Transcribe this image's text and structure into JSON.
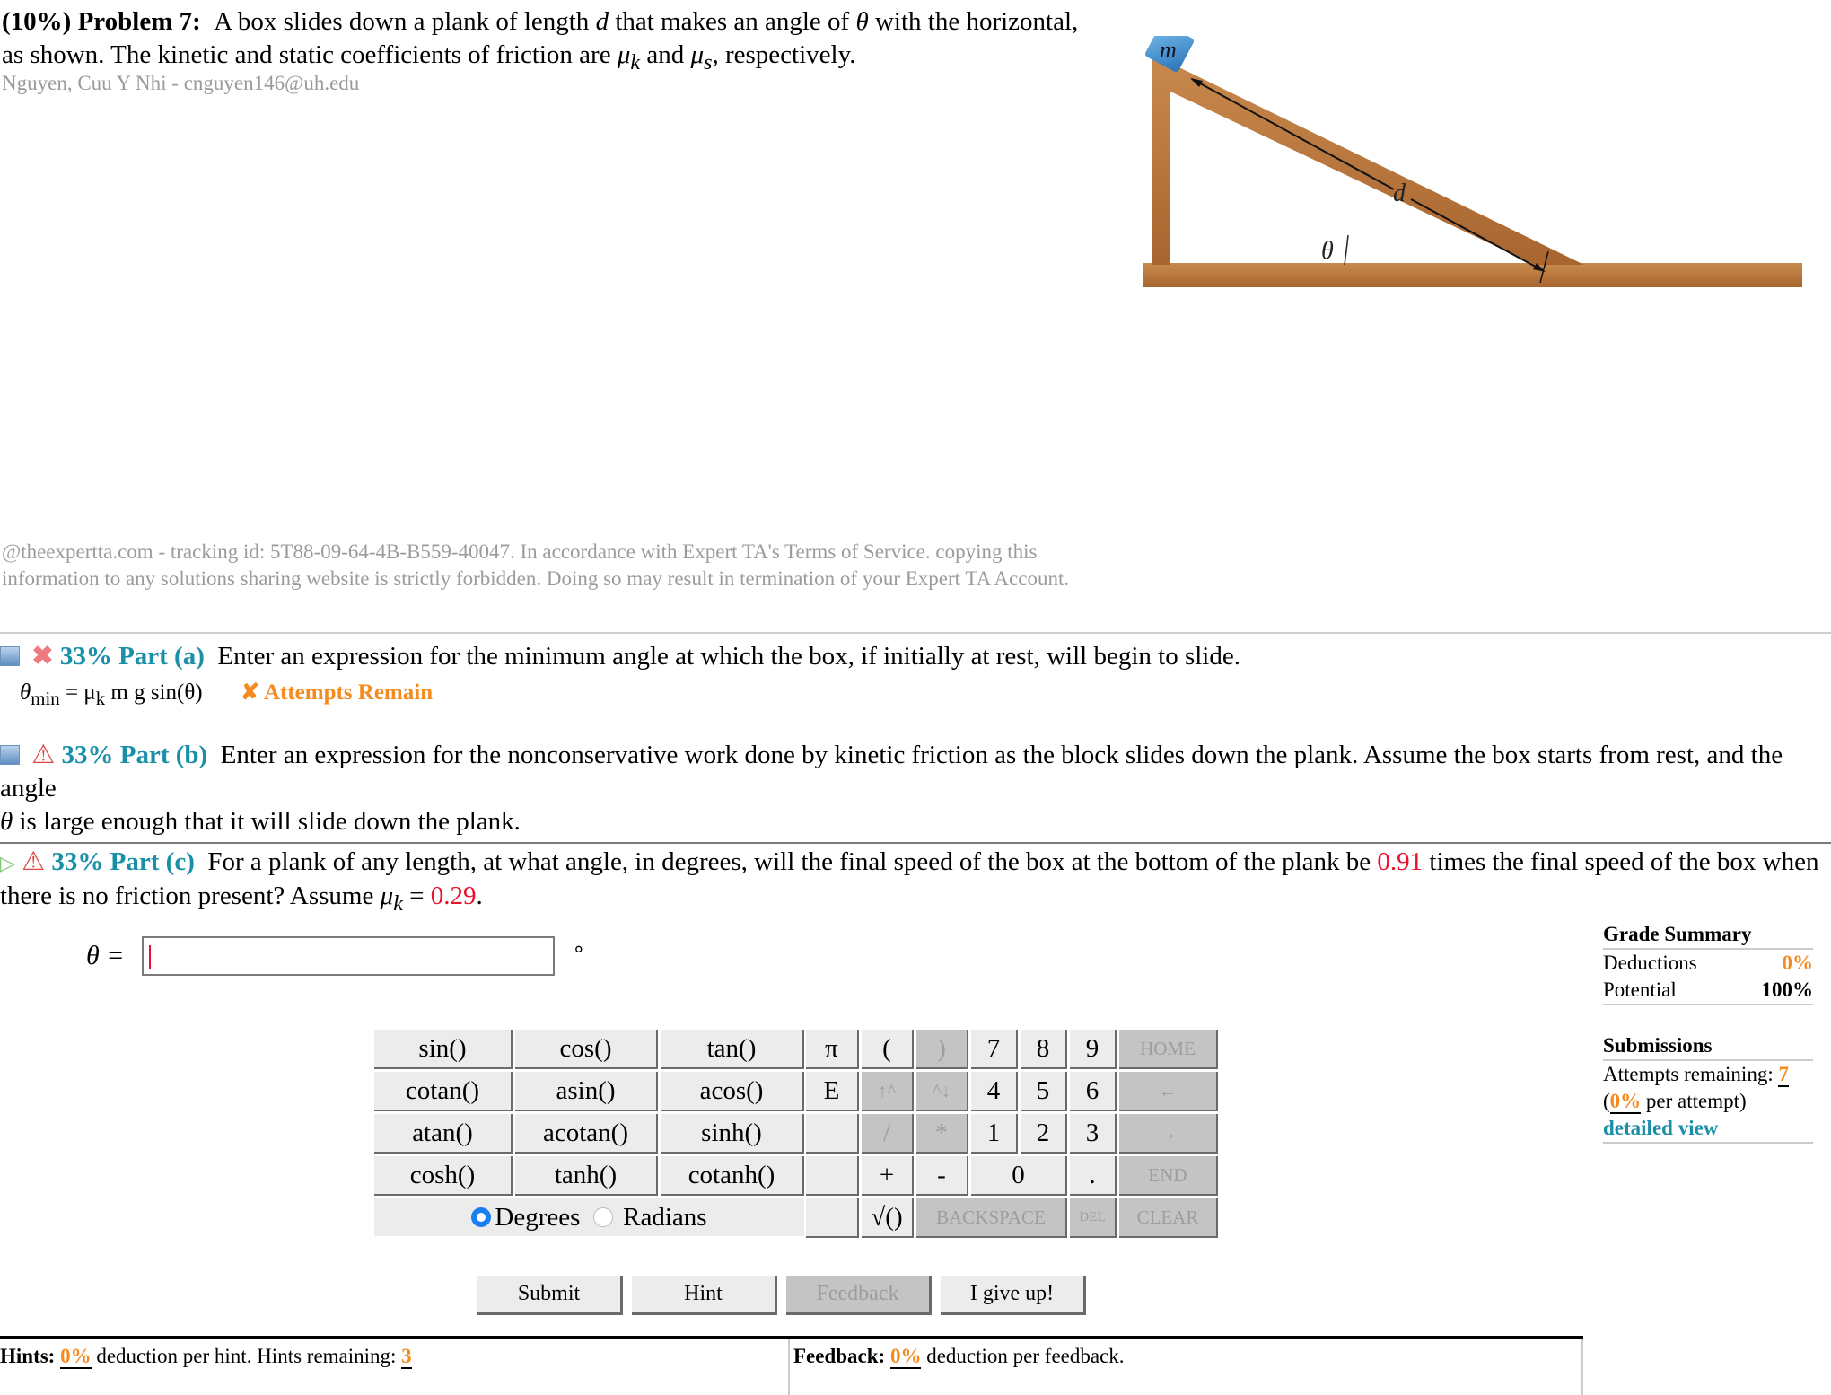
{
  "problem": {
    "weight": "(10%)",
    "label": "Problem 7:",
    "text_1": "A box slides down a plank of length",
    "var_d": "d",
    "text_2": "that makes an angle of",
    "var_theta": "θ",
    "text_3": "with the horizontal, as shown. The kinetic and static coefficients of friction are",
    "mu_k": "μ",
    "mu_k_sub": "k",
    "and": "and",
    "mu_s": "μ",
    "mu_s_sub": "s",
    "text_4": ", respectively.",
    "student": "Nguyen, Cuu Y Nhi - cnguyen146@uh.edu"
  },
  "figure": {
    "mass_label": "m",
    "length_label": "d",
    "angle_label": "θ",
    "colors": {
      "wood": "#b8763e",
      "box": "#3f8fd1"
    }
  },
  "copyright": "@theexpertta.com - tracking id: 5T88-09-64-4B-B559-40047. In accordance with Expert TA's Terms of Service. copying this information to any solutions sharing website is strictly forbidden. Doing so may result in termination of your Expert TA Account.",
  "parts": {
    "a": {
      "icon": "collapse-icon",
      "status_icon": "incorrect-icon",
      "tag": "33% Part (a)",
      "text": "Enter an expression for the minimum angle at which the box, if initially at rest, will begin to slide.",
      "answer_lhs": "θ",
      "answer_lhs_sub": "min",
      "answer_rhs": "= μ",
      "answer_rhs_sub": "k",
      "answer_rest": " m g sin(θ)",
      "status": "✘ Attempts Remain"
    },
    "b": {
      "tag": "33% Part (b)",
      "text_1": "Enter an expression for the nonconservative work done by kinetic friction as the block slides down the plank. Assume the box starts from rest, and the angle",
      "theta": "θ",
      "text_2": "is large enough that it will slide down the plank."
    },
    "c": {
      "tag": "33% Part (c)",
      "text_1": "For a plank of any length, at what angle, in degrees, will the final speed of the box at the bottom of the plank be",
      "ratio": "0.91",
      "text_2": "times the final speed of the box when there is no friction present? Assume",
      "mu": "μ",
      "mu_sub": "k",
      "eq": "=",
      "mu_value": "0.29",
      "period": "."
    }
  },
  "answer": {
    "label": "θ =",
    "value": "",
    "unit": "°"
  },
  "calculator": {
    "functions": [
      [
        "sin()",
        "cos()",
        "tan()"
      ],
      [
        "cotan()",
        "asin()",
        "acos()"
      ],
      [
        "atan()",
        "acotan()",
        "sinh()"
      ],
      [
        "cosh()",
        "tanh()",
        "cotanh()"
      ]
    ],
    "mode": {
      "degrees": "Degrees",
      "radians": "Radians",
      "selected": "Degrees"
    },
    "keys": {
      "pi": "π",
      "lparen": "(",
      "rparen": ")",
      "k7": "7",
      "k8": "8",
      "k9": "9",
      "home": "HOME",
      "E": "E",
      "up": "↑^",
      "down": "^↓",
      "k4": "4",
      "k5": "5",
      "k6": "6",
      "left": "←",
      "div": "/",
      "mul": "*",
      "k1": "1",
      "k2": "2",
      "k3": "3",
      "right": "→",
      "plus": "+",
      "minus": "-",
      "k0": "0",
      "dot": ".",
      "end": "END",
      "sqrt": "√()",
      "backspace": "BACKSPACE",
      "del": "DEL",
      "clear": "CLEAR"
    }
  },
  "grade_summary": {
    "title": "Grade Summary",
    "deductions_label": "Deductions",
    "deductions_value": "0%",
    "potential_label": "Potential",
    "potential_value": "100%"
  },
  "submissions": {
    "title": "Submissions",
    "attempts_label": "Attempts remaining:",
    "attempts_value": "7",
    "per_attempt_open": "(",
    "per_attempt_value": "0%",
    "per_attempt_text": " per attempt)",
    "detailed_link": "detailed view"
  },
  "buttons": {
    "submit": "Submit",
    "hint": "Hint",
    "feedback": "Feedback",
    "give_up": "I give up!"
  },
  "hints": {
    "label": "Hints:",
    "value": "0%",
    "text": "deduction per hint. Hints remaining:",
    "remaining": "3"
  },
  "feedback": {
    "label": "Feedback:",
    "value": "0%",
    "text": "deduction per feedback."
  }
}
